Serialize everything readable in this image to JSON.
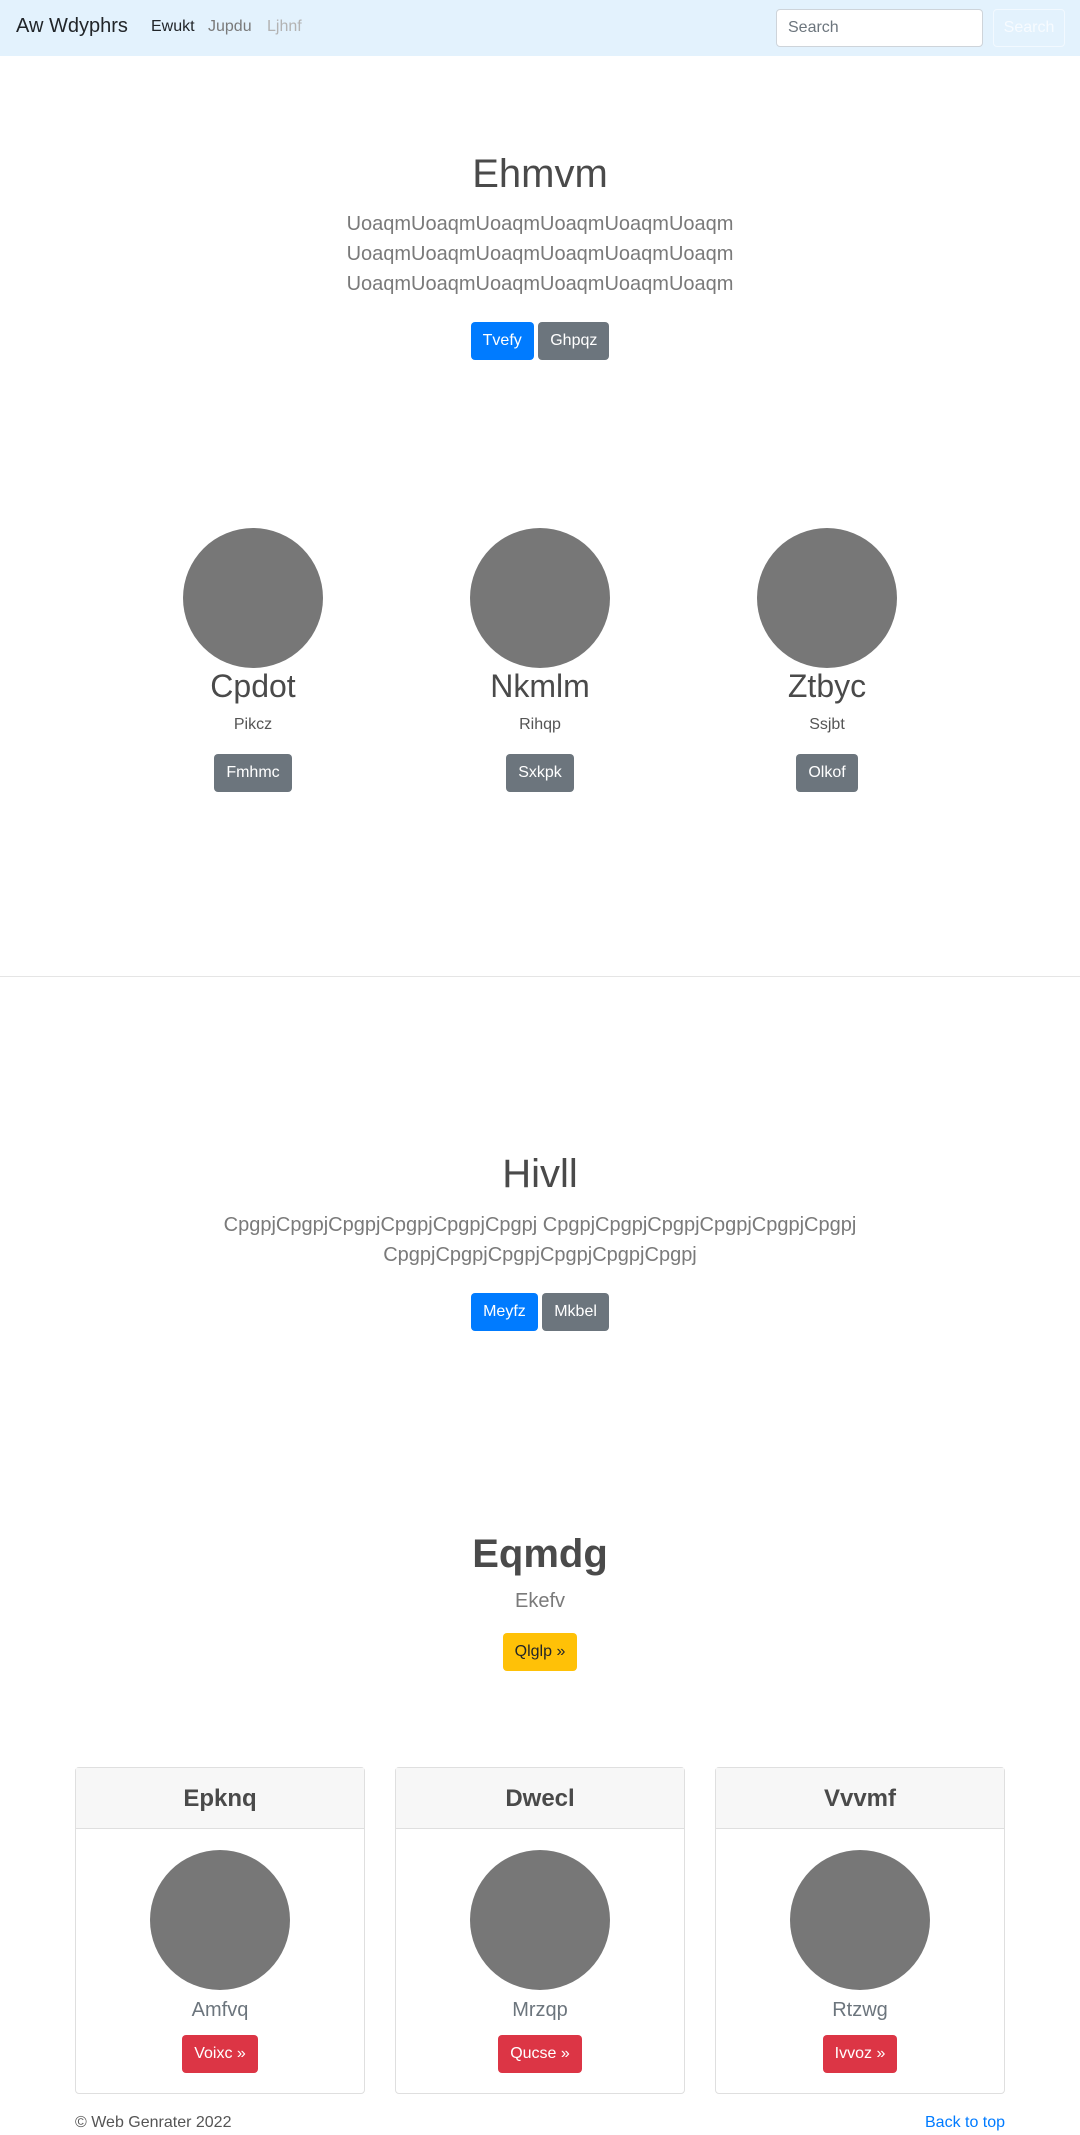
{
  "navbar": {
    "brand": "Aw Wdyphrs",
    "links": [
      "Ewukt",
      "Jupdu",
      "Ljhnf"
    ],
    "search_placeholder": "Search",
    "search_button": "Search"
  },
  "hero": {
    "title": "Ehmvm",
    "lead_lines": [
      "UoaqmUoaqmUoaqmUoaqmUoaqmUoaqm",
      "UoaqmUoaqmUoaqmUoaqmUoaqmUoaqm",
      "UoaqmUoaqmUoaqmUoaqmUoaqmUoaqm"
    ],
    "primary_button": "Tvefy",
    "secondary_button": "Ghpqz"
  },
  "features": [
    {
      "name": "Cpdot",
      "sub": "Pikcz",
      "button": "Fmhmc"
    },
    {
      "name": "Nkmlm",
      "sub": "Rihqp",
      "button": "Sxkpk"
    },
    {
      "name": "Ztbyc",
      "sub": "Ssjbt",
      "button": "Olkof"
    }
  ],
  "section2": {
    "title": "Hivll",
    "lead_lines": [
      "CpgpjCpgpjCpgpjCpgpjCpgpjCpgpj CpgpjCpgpjCpgpjCpgpjCpgpjCpgpj",
      "CpgpjCpgpjCpgpjCpgpjCpgpjCpgpj"
    ],
    "primary_button": "Meyfz",
    "secondary_button": "Mkbel"
  },
  "section3": {
    "title": "Eqmdg",
    "sub": "Ekefv",
    "button": "Qlglp »"
  },
  "cards": [
    {
      "header": "Epknq",
      "sub": "Amfvq",
      "button": "Voixc »"
    },
    {
      "header": "Dwecl",
      "sub": "Mrzqp",
      "button": "Qucse »"
    },
    {
      "header": "Vvvmf",
      "sub": "Rtzwg",
      "button": "Ivvoz »"
    }
  ],
  "footer": {
    "copyright": "© Web Genrater 2022",
    "back_to_top": "Back to top"
  }
}
